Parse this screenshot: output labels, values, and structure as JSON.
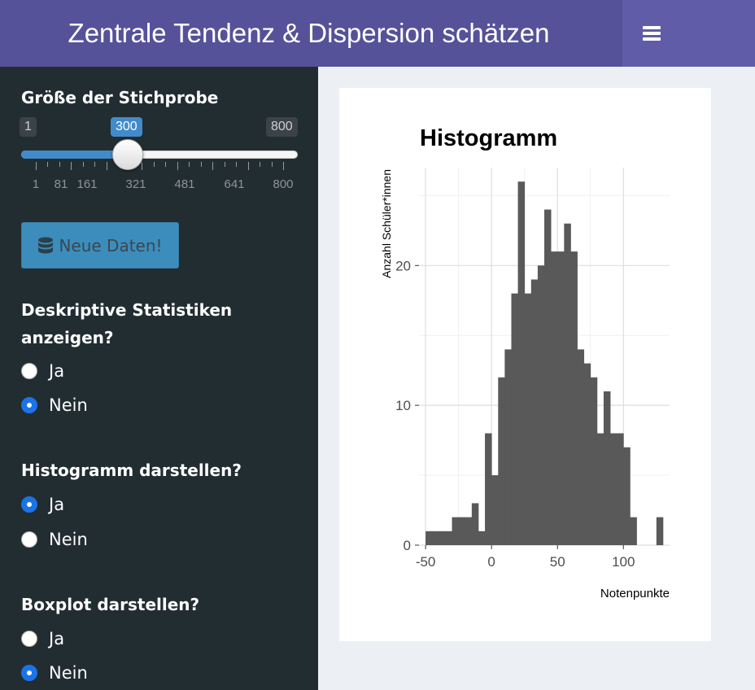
{
  "header": {
    "title": "Zentrale Tendenz & Dispersion schätzen",
    "menu_icon": "bars-icon"
  },
  "sidebar": {
    "sample_size": {
      "label": "Größe der Stichprobe",
      "min": "1",
      "max": "800",
      "value": "300",
      "value_fraction": 0.374,
      "tick_labels": [
        "1",
        "81",
        "161",
        "321",
        "481",
        "641",
        "800"
      ]
    },
    "new_data_button": {
      "label": "Neue Daten!",
      "icon": "database-icon"
    },
    "descriptive": {
      "label_line1": "Deskriptive Statistiken",
      "label_line2": "anzeigen?",
      "options": [
        "Ja",
        "Nein"
      ],
      "selected": "Nein"
    },
    "histogram": {
      "label": "Histogramm darstellen?",
      "options": [
        "Ja",
        "Nein"
      ],
      "selected": "Ja"
    },
    "boxplot": {
      "label": "Boxplot darstellen?",
      "options": [
        "Ja",
        "Nein"
      ],
      "selected": "Nein"
    }
  },
  "chart_data": {
    "type": "bar",
    "title": "Histogramm",
    "xlabel": "Notenpunkte",
    "ylabel": "Anzahl Schüler*innen",
    "bin_width": 5,
    "bin_starts": [
      -50,
      -45,
      -40,
      -35,
      -30,
      -25,
      -20,
      -15,
      -10,
      -5,
      0,
      5,
      10,
      15,
      20,
      25,
      30,
      35,
      40,
      45,
      50,
      55,
      60,
      65,
      70,
      75,
      80,
      85,
      90,
      95,
      100,
      105,
      110,
      115,
      120,
      125
    ],
    "values": [
      1,
      1,
      1,
      1,
      2,
      2,
      2,
      3,
      1,
      8,
      5,
      12,
      14,
      18,
      26,
      18,
      19,
      20,
      24,
      21,
      21,
      23,
      21,
      14,
      13,
      12,
      8,
      11,
      8,
      8,
      7,
      2,
      0,
      0,
      0,
      2
    ],
    "xlim": [
      -55,
      135
    ],
    "ylim": [
      0,
      27
    ],
    "x_ticks": [
      "-50",
      "0",
      "50",
      "100"
    ],
    "y_ticks": [
      "0",
      "10",
      "20"
    ],
    "grid": true,
    "bar_color": "#595959"
  }
}
